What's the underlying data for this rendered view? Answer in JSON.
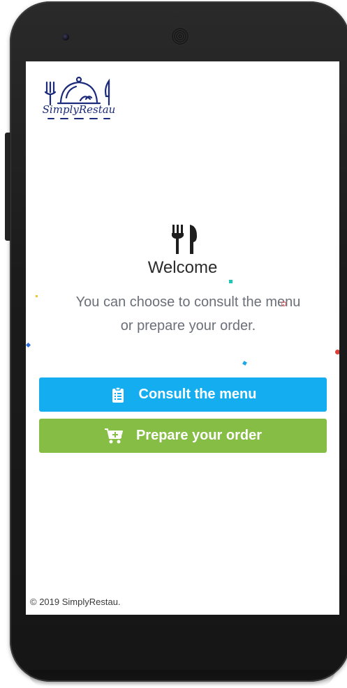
{
  "app": {
    "logo_text": "SimplyRestau"
  },
  "main": {
    "welcome_title": "Welcome",
    "subtitle_line1": "You can choose to consult the menu",
    "subtitle_line2": "or prepare your order."
  },
  "actions": {
    "consult_menu_label": "Consult the menu",
    "prepare_order_label": "Prepare your order"
  },
  "footer": {
    "copyright": "© 2019 SimplyRestau."
  },
  "colors": {
    "primary_blue": "#14aef0",
    "primary_green": "#86bd44",
    "logo_navy": "#1b2a7a"
  },
  "icons": {
    "header": "cutlery-icon",
    "menu_button": "clipboard-list-icon",
    "order_button": "cart-plus-icon"
  }
}
